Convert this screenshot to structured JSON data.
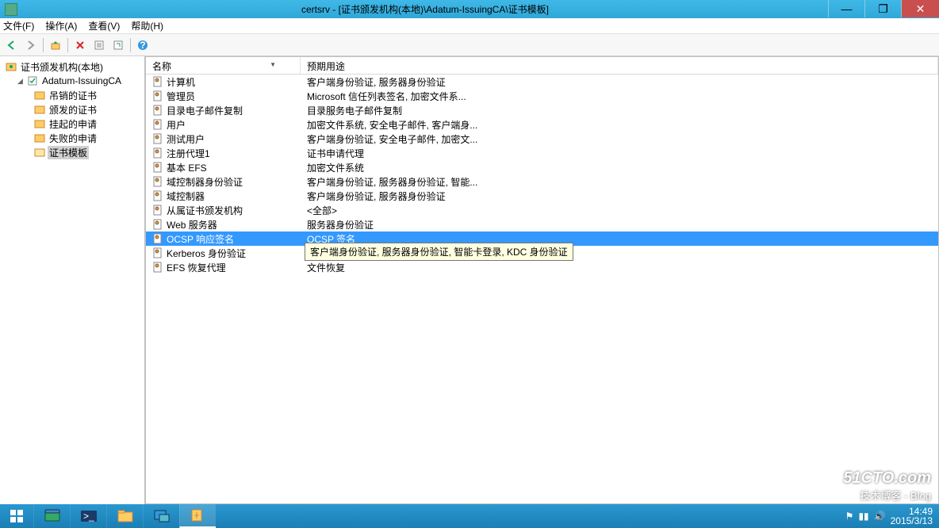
{
  "window": {
    "title": "certsrv - [证书颁发机构(本地)\\Adatum-IssuingCA\\证书模板]"
  },
  "menu": {
    "file": "文件(F)",
    "action": "操作(A)",
    "view": "查看(V)",
    "help": "帮助(H)"
  },
  "tree": {
    "root": "证书颁发机构(本地)",
    "ca": "Adatum-IssuingCA",
    "nodes": {
      "revoked": "吊销的证书",
      "issued": "颁发的证书",
      "pending": "挂起的申请",
      "failed": "失败的申请",
      "templates": "证书模板"
    }
  },
  "columns": {
    "name": "名称",
    "purpose": "预期用途"
  },
  "rows": [
    {
      "name": "计算机",
      "purpose": "客户端身份验证, 服务器身份验证"
    },
    {
      "name": "管理员",
      "purpose": "Microsoft 信任列表签名, 加密文件系..."
    },
    {
      "name": "目录电子邮件复制",
      "purpose": "目录服务电子邮件复制"
    },
    {
      "name": "用户",
      "purpose": "加密文件系统, 安全电子邮件, 客户端身..."
    },
    {
      "name": "测试用户",
      "purpose": "客户端身份验证, 安全电子邮件, 加密文..."
    },
    {
      "name": "注册代理1",
      "purpose": "证书申请代理"
    },
    {
      "name": "基本 EFS",
      "purpose": "加密文件系统"
    },
    {
      "name": "域控制器身份验证",
      "purpose": "客户端身份验证, 服务器身份验证, 智能..."
    },
    {
      "name": "域控制器",
      "purpose": "客户端身份验证, 服务器身份验证"
    },
    {
      "name": "从属证书颁发机构",
      "purpose": "<全部>"
    },
    {
      "name": "Web 服务器",
      "purpose": "服务器身份验证"
    },
    {
      "name": "OCSP 响应签名",
      "purpose": "OCSP 签名"
    },
    {
      "name": "Kerberos 身份验证",
      "purpose": "客户端身份验证, 服务器身份验证, 智能卡登录, KDC 身份验证"
    },
    {
      "name": "EFS 恢复代理",
      "purpose": "文件恢复"
    }
  ],
  "selected_index": 11,
  "tooltip_index": 12,
  "tooltip_text": "客户端身份验证, 服务器身份验证, 智能卡登录, KDC 身份验证",
  "tray": {
    "time": "14:49",
    "date": "2015/3/13"
  },
  "watermark": {
    "line1": "51CTO.com",
    "line2": "技术博客  -  Blog"
  }
}
